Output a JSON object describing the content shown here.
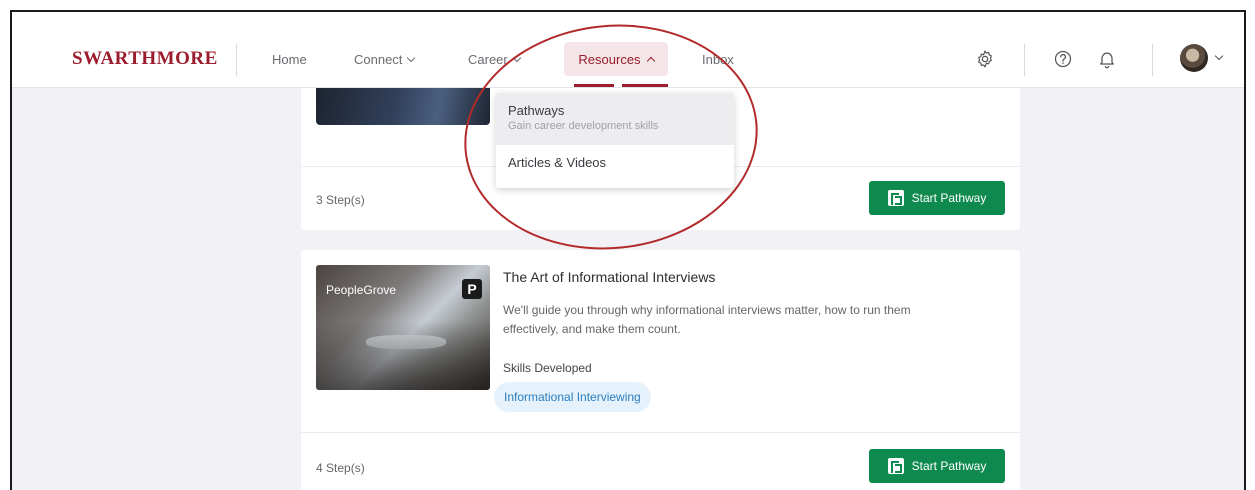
{
  "nav": {
    "brand": "SWARTHMORE",
    "home": "Home",
    "connect": "Connect",
    "career": "Career",
    "resources": "Resources",
    "inbox": "Inbox"
  },
  "dropdown": {
    "items": [
      {
        "title": "Pathways",
        "subtitle": "Gain career development skills"
      },
      {
        "title": "Articles & Videos"
      }
    ]
  },
  "cards": [
    {
      "steps": "3 Step(s)",
      "button": "Start Pathway"
    },
    {
      "thumb_label": "PeopleGrove",
      "thumb_logo": "P",
      "title": "The Art of Informational Interviews",
      "description": "We'll guide you through why informational interviews matter, how to run them effectively, and make them count.",
      "skills_label": "Skills Developed",
      "skills": [
        "Informational Interviewing"
      ],
      "steps": "4 Step(s)",
      "button": "Start Pathway"
    }
  ],
  "colors": {
    "brand": "#9b1c2c",
    "accent_green": "#0f8a4f",
    "tag_blue": "#2a7ec1",
    "annotation": "#b22a2a"
  },
  "icons": [
    "gear-icon",
    "help-icon",
    "bell-icon",
    "chevron-down-icon",
    "pathway-logo-icon"
  ]
}
